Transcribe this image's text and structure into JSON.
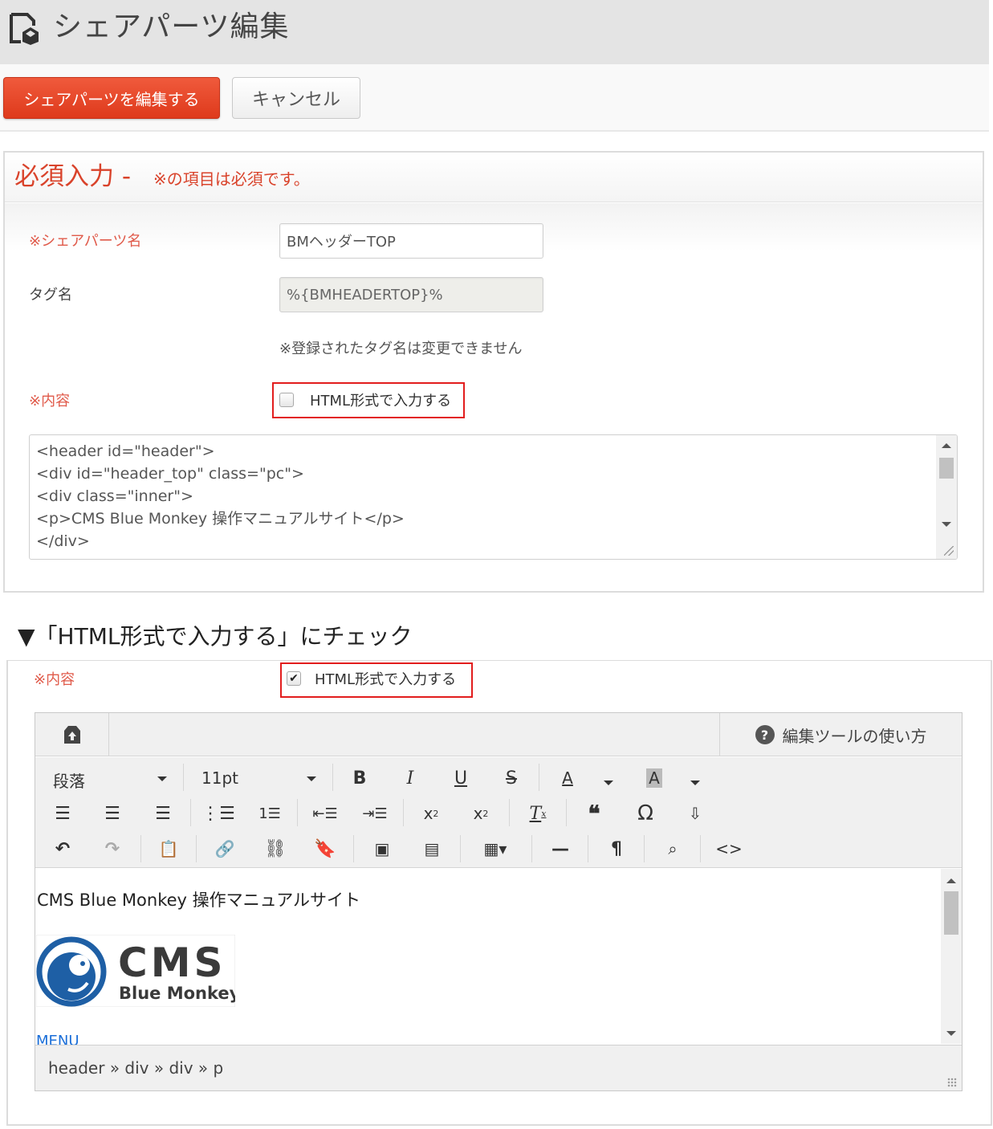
{
  "header": {
    "title": "シェアパーツ編集"
  },
  "actions": {
    "save_label": "シェアパーツを編集する",
    "cancel_label": "キャンセル"
  },
  "section": {
    "title": "必須入力 -",
    "note": "※の項目は必須です。"
  },
  "form": {
    "name_label": "※シェアパーツ名",
    "name_value": "BMヘッダーTOP",
    "tag_label": "タグ名",
    "tag_value": "%{BMHEADERTOP}%",
    "tag_hint": "※登録されたタグ名は変更できません",
    "content_label": "※内容",
    "html_checkbox_label": "HTML形式で入力する",
    "html_checkbox_checked": false,
    "code_lines": [
      "<header id=\"header\">",
      "<div id=\"header_top\" class=\"pc\">",
      "<div class=\"inner\">",
      "<p>CMS Blue Monkey 操作マニュアルサイト</p>",
      "</div>"
    ]
  },
  "caption": "▼「HTML形式で入力する」にチェック",
  "form2": {
    "content_label": "※内容",
    "html_checkbox_label": "HTML形式で入力する",
    "html_checkbox_checked": true
  },
  "editor": {
    "help_label": "編集ツールの使い方",
    "toolbar": {
      "format_select": "段落",
      "size_select": "11pt",
      "row1_icons": [
        "bold-icon",
        "italic-icon",
        "underline-icon",
        "strikethrough-icon",
        "text-color-icon",
        "background-color-icon"
      ],
      "row2_icons": [
        "align-left-icon",
        "align-center-icon",
        "align-right-icon",
        "bullet-list-icon",
        "numbered-list-icon",
        "outdent-icon",
        "indent-icon",
        "subscript-icon",
        "superscript-icon",
        "clear-format-icon",
        "blockquote-icon",
        "special-char-icon",
        "anchor-insert-icon"
      ],
      "row3_icons": [
        "undo-icon",
        "redo-icon",
        "paste-icon",
        "link-icon",
        "unlink-icon",
        "bookmark-icon",
        "image-icon",
        "media-icon",
        "table-icon",
        "horizontal-rule-icon",
        "paragraph-mark-icon",
        "find-icon",
        "source-code-icon"
      ]
    },
    "content_text": "CMS Blue Monkey 操作マニュアルサイト",
    "logo_text_main": "CMS",
    "logo_text_sub": "Blue Monkey",
    "menu_text": "MENU",
    "status_path": "header » div » div » p"
  },
  "colors": {
    "accent": "#e03c1f",
    "required": "#d9432b",
    "highlight": "#e21d1d",
    "link": "#1a6ed8",
    "logo": "#1e5fa5"
  }
}
